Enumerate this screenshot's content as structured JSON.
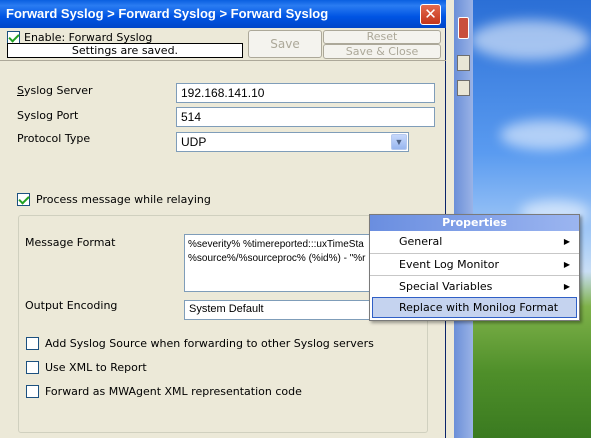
{
  "window": {
    "title": "Forward Syslog > Forward Syslog > Forward Syslog",
    "close_glyph": "✕"
  },
  "header": {
    "enable_label": "Enable: Forward Syslog",
    "enable_checked": true,
    "status_text": "Settings are saved.",
    "save_label": "Save",
    "reset_label": "Reset",
    "save_close_label": "Save & Close"
  },
  "form": {
    "server_label": "Syslog Server",
    "server_value": "192.168.141.10",
    "port_label": "Syslog Port",
    "port_value": "514",
    "protocol_label": "Protocol Type",
    "protocol_value": "UDP",
    "process_label": "Process message while relaying",
    "process_checked": true,
    "message_format_label": "Message Format",
    "message_format_line1": "%severity% %timereported:::uxTimeSta",
    "message_format_line2": "%source%/%sourceproc% (%id%) - \"%r",
    "output_encoding_label": "Output Encoding",
    "output_encoding_value": "System Default",
    "options": [
      {
        "label": "Add Syslog Source when forwarding to other Syslog servers",
        "checked": false
      },
      {
        "label": "Use XML to Report",
        "checked": false
      },
      {
        "label": "Forward as MWAgent XML representation code",
        "checked": false
      }
    ]
  },
  "context_menu": {
    "title": "Properties",
    "items": [
      {
        "label": "General",
        "submenu_glyph": "▶"
      },
      {
        "label": "Event Log Monitor",
        "submenu_glyph": "▶"
      },
      {
        "label": "Special Variables",
        "submenu_glyph": "▶"
      },
      {
        "label": "Replace with Monilog Format",
        "submenu_glyph": ""
      }
    ]
  },
  "colors": {
    "titlebar": "#0054e3",
    "dialog_bg": "#ece9d8",
    "menu_highlight": "#c5d3ef",
    "checkmark": "#21a121"
  }
}
